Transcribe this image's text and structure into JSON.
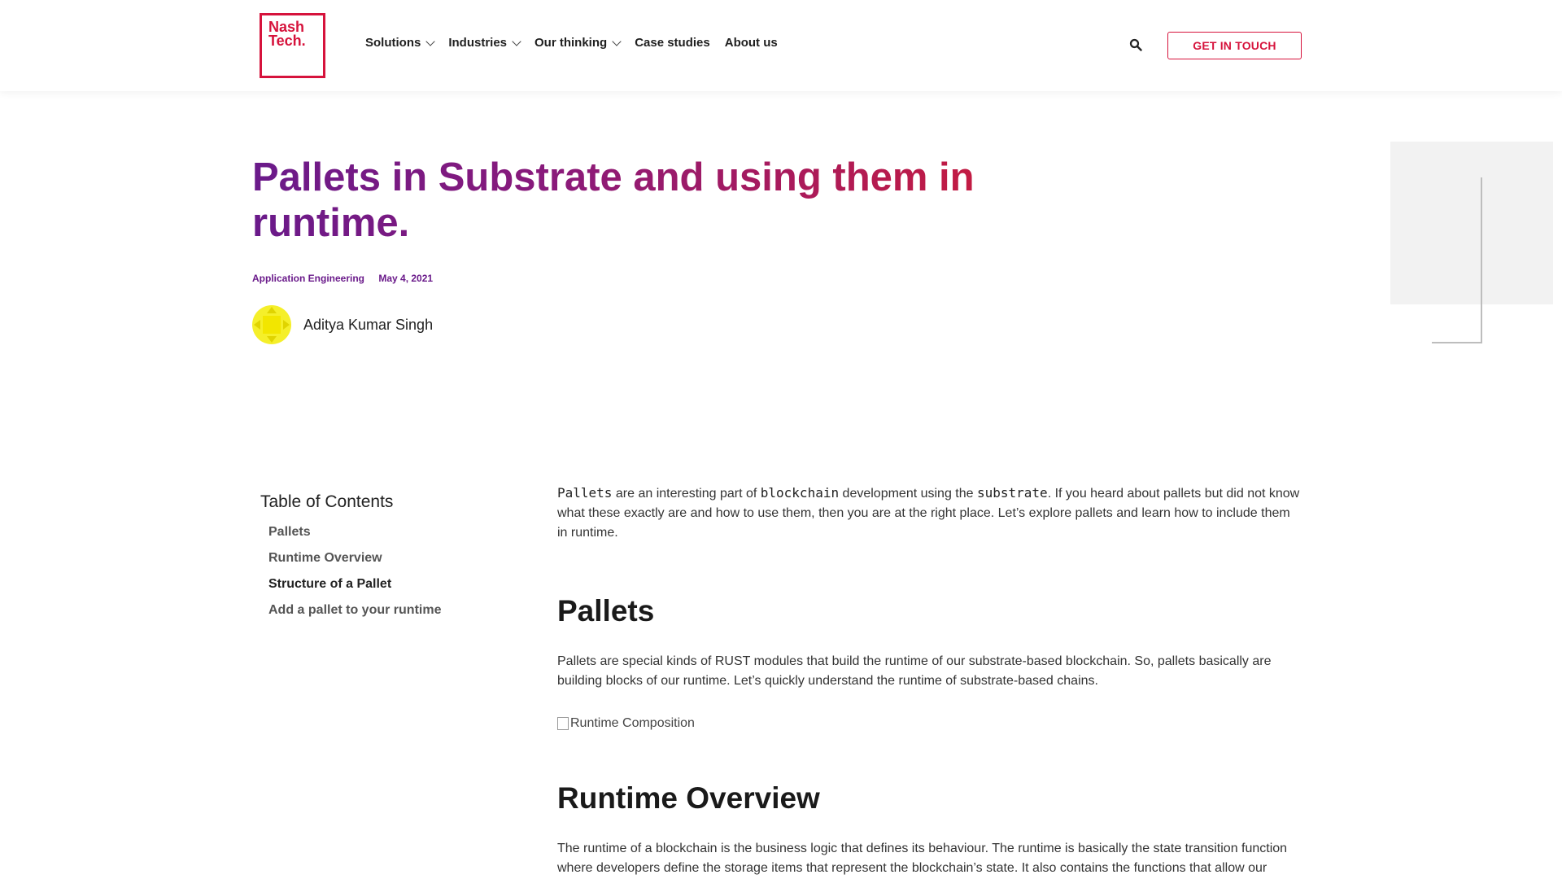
{
  "header": {
    "logo_line1": "Nash",
    "logo_line2": "Tech.",
    "nav": [
      {
        "label": "Solutions",
        "has_dropdown": true
      },
      {
        "label": "Industries",
        "has_dropdown": true
      },
      {
        "label": "Our thinking",
        "has_dropdown": true
      },
      {
        "label": "Case studies",
        "has_dropdown": false
      },
      {
        "label": "About us",
        "has_dropdown": false
      }
    ],
    "search_icon": "search-icon",
    "cta_label": "GET IN TOUCH"
  },
  "hero": {
    "title": "Pallets in Substrate and using them in runtime.",
    "category": "Application Engineering",
    "date": "May 4, 2021",
    "author": "Aditya Kumar Singh"
  },
  "toc": {
    "title": "Table of Contents",
    "items": [
      "Pallets",
      "Runtime Overview",
      "Structure of a Pallet",
      "Add a pallet to your runtime"
    ]
  },
  "article": {
    "intro_code1": "Pallets",
    "intro_text1": " are an interesting part of ",
    "intro_code2": "blockchain",
    "intro_text2": " development using the ",
    "intro_code3": "substrate",
    "intro_text3": ". If you heard about pallets but did not know what these exactly are and how to use them, then you are at the right place. Let’s explore pallets and learn how to include them in runtime.",
    "h_pallets": "Pallets",
    "p_pallets": "Pallets are special kinds of RUST modules that build the runtime of our substrate-based blockchain. So, pallets basically are building blocks of our runtime. Let’s quickly understand the runtime of substrate-based chains.",
    "img_alt": "Runtime Composition",
    "h_runtime": "Runtime Overview",
    "p_runtime": "The runtime of a blockchain is the business logic that defines its behaviour. The runtime is basically the state transition function where developers define the storage items that represent the blockchain’s state. It also contains the functions that allow our blockchain to change to different states."
  },
  "colors": {
    "brand_red": "#d6133c",
    "title_purple": "#6a1a8a",
    "avatar_yellow": "#f5ef2a"
  }
}
